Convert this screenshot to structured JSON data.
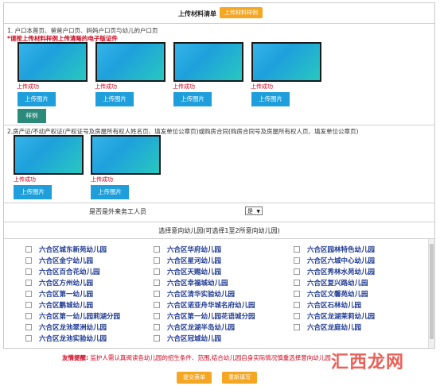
{
  "header": {
    "title": "上传材料清单",
    "sample_button": "上传材料样例"
  },
  "section1": {
    "title": "1. 户口本首页、爸爸户口页、妈妈户口页与幼儿的户口页",
    "warning": "*请按上传材料样例上传清晰的电子版证件",
    "items": [
      {
        "status": "上传成功",
        "button": "上传图片"
      },
      {
        "status": "上传成功",
        "button": "上传图片"
      },
      {
        "status": "上传成功",
        "button": "上传图片"
      },
      {
        "status": "上传成功",
        "button": "上传图片"
      }
    ],
    "example_button": "样例"
  },
  "section2": {
    "title": "2.房产证/不动产权证(产权证号及房屋所有权人姓名页、填发单位公章页)或购房合同(购房合同号及房屋所有权人页、填发单位公章页)",
    "items": [
      {
        "status": "上传成功",
        "button": "上传图片"
      },
      {
        "status": "上传成功",
        "button": "上传图片"
      }
    ]
  },
  "migrant": {
    "question": "是否是外来务工人员",
    "select_value": "是"
  },
  "kindergartens": {
    "title": "选择意向幼儿园(可选择1至2所意向幼儿园)",
    "columns": [
      [
        "六合区城东新苑幼儿园",
        "六合区金宁幼儿园",
        "六合区百合花幼儿园",
        "六合区方州幼儿园",
        "六合区第一幼儿园",
        "六合区鹏城幼儿园",
        "六合区第一幼儿园莉湖分园",
        "六合区龙池翠洲幼儿园",
        "六合区龙池实验幼儿园"
      ],
      [
        "六合区华府幼儿园",
        "六合区星河幼儿园",
        "六合区天赐幼儿园",
        "六合区幸福城幼儿园",
        "六合区清华实验幼儿园",
        "六合区诺亚舟华城名府幼儿园",
        "六合区第一幼儿园花语城分园",
        "六合区龙湖半岛幼儿园",
        "六合区冠城幼儿园"
      ],
      [
        "六合区园林特色幼儿园",
        "六合区六城中心幼儿园",
        "六合区秀林水苑幼儿园",
        "六合区复兴路幼儿园",
        "六合区文馨苑幼儿园",
        "六合区石林幼儿园",
        "六合区龙湖茉莉幼儿园",
        "六合区龙庭幼儿园"
      ]
    ]
  },
  "notice": {
    "label": "友情提醒:",
    "text": "监护人需认真阅读各幼儿园的招生条件、范围,结合幼儿园自身实际情况慎重选择意向幼儿园"
  },
  "actions": {
    "submit": "提交表单",
    "reset": "重新填写"
  },
  "watermark": "汇西龙网"
}
